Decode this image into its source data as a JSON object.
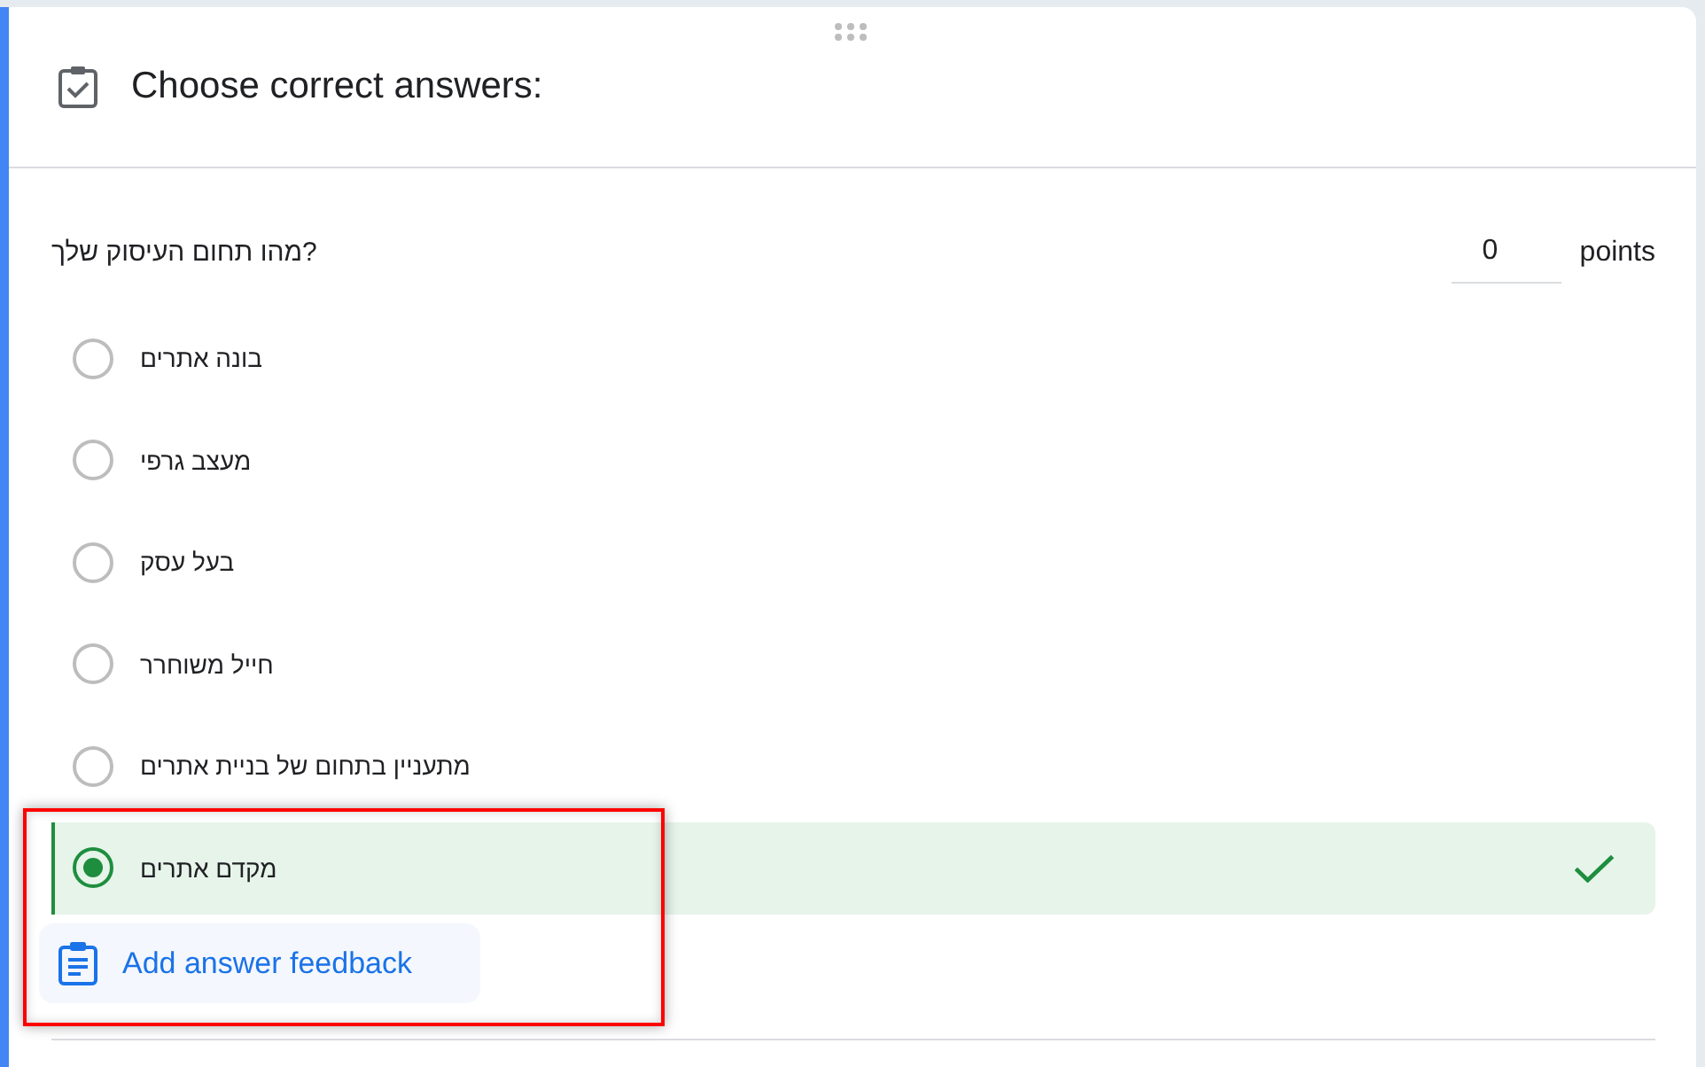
{
  "header": {
    "title": "Choose correct answers:"
  },
  "question": {
    "text": "מהו תחום העיסוק שלך?",
    "points": {
      "value": "0",
      "label": "points"
    }
  },
  "options": [
    {
      "label": "בונה אתרים",
      "selected": false
    },
    {
      "label": "מעצב גרפי",
      "selected": false
    },
    {
      "label": "בעל עסק",
      "selected": false
    },
    {
      "label": "חייל משוחרר",
      "selected": false
    },
    {
      "label": "מתעניין בתחום של בניית אתרים",
      "selected": false
    },
    {
      "label": "מקדם אתרים",
      "selected": true
    }
  ],
  "feedback_button": {
    "label": "Add answer feedback"
  }
}
